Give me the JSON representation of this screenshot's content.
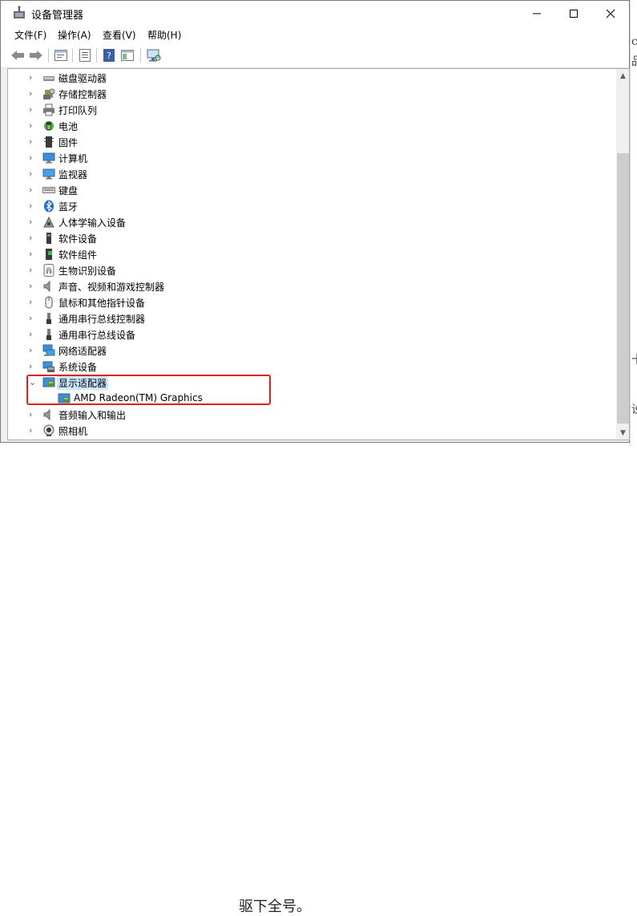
{
  "window": {
    "title": "设备管理器",
    "menu": [
      "文件(F)",
      "操作(A)",
      "查看(V)",
      "帮助(H)"
    ]
  },
  "toolbar": {
    "buttons": [
      "back-icon",
      "forward-icon",
      "properties-icon",
      "show-hidden-icon",
      "help-icon",
      "view-icon",
      "monitor-scan-icon"
    ]
  },
  "tree": {
    "items": [
      {
        "label": "磁盘驱动器",
        "icon": "disk-drive-icon",
        "expanded": false
      },
      {
        "label": "存储控制器",
        "icon": "storage-controller-icon",
        "expanded": false
      },
      {
        "label": "打印队列",
        "icon": "printer-icon",
        "expanded": false
      },
      {
        "label": "电池",
        "icon": "battery-icon",
        "expanded": false
      },
      {
        "label": "固件",
        "icon": "firmware-icon",
        "expanded": false
      },
      {
        "label": "计算机",
        "icon": "computer-icon",
        "expanded": false
      },
      {
        "label": "监视器",
        "icon": "monitor-icon",
        "expanded": false
      },
      {
        "label": "键盘",
        "icon": "keyboard-icon",
        "expanded": false
      },
      {
        "label": "蓝牙",
        "icon": "bluetooth-icon",
        "expanded": false
      },
      {
        "label": "人体学输入设备",
        "icon": "hid-icon",
        "expanded": false
      },
      {
        "label": "软件设备",
        "icon": "software-device-icon",
        "expanded": false
      },
      {
        "label": "软件组件",
        "icon": "software-component-icon",
        "expanded": false
      },
      {
        "label": "生物识别设备",
        "icon": "biometric-icon",
        "expanded": false
      },
      {
        "label": "声音、视频和游戏控制器",
        "icon": "sound-icon",
        "expanded": false
      },
      {
        "label": "鼠标和其他指针设备",
        "icon": "mouse-icon",
        "expanded": false
      },
      {
        "label": "通用串行总线控制器",
        "icon": "usb-icon",
        "expanded": false
      },
      {
        "label": "通用串行总线设备",
        "icon": "usb-device-icon",
        "expanded": false
      },
      {
        "label": "网络适配器",
        "icon": "network-adapter-icon",
        "expanded": false
      },
      {
        "label": "系统设备",
        "icon": "system-device-icon",
        "expanded": false
      },
      {
        "label": "显示适配器",
        "icon": "display-adapter-icon",
        "expanded": true
      },
      {
        "label": "AMD Radeon(TM) Graphics",
        "icon": "display-adapter-icon",
        "child": true
      },
      {
        "label": "音频输入和输出",
        "icon": "audio-io-icon",
        "expanded": false
      },
      {
        "label": "照相机",
        "icon": "camera-icon",
        "expanded": false
      }
    ]
  },
  "background": {
    "bottom_text": "驱下全号。",
    "right_fragments": [
      "cl",
      "品",
      "十",
      "设"
    ]
  },
  "colors": {
    "highlight_border": "#e0211b",
    "selection": "#cce8ff"
  }
}
